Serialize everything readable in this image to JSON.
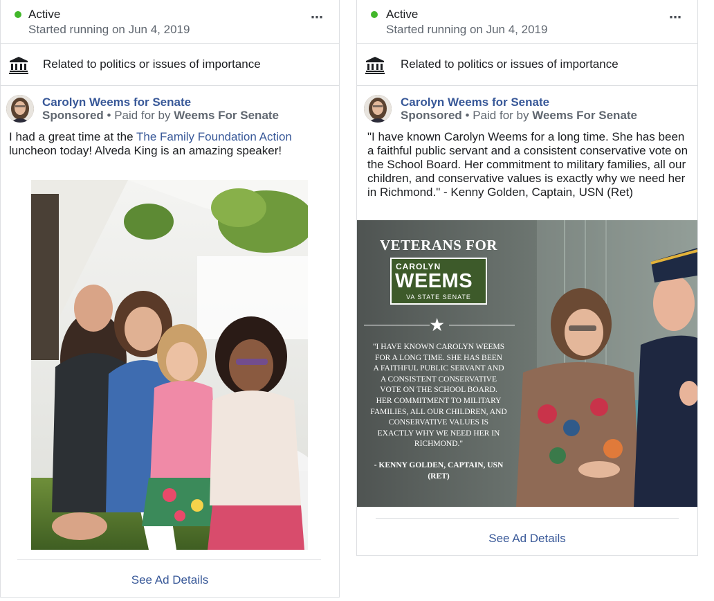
{
  "ads": [
    {
      "status": "Active",
      "started": "Started running on Jun 4, 2019",
      "more_icon": "⋯",
      "category": "Related to politics or issues of importance",
      "page_name": "Carolyn Weems for Senate",
      "sponsored": "Sponsored",
      "bullet": "•",
      "paid_for_prefix": "Paid for by",
      "paid_for_by": "Weems For Senate",
      "text_before_link": "I had a great time at the ",
      "link_text": "The Family Foundation Action",
      "text_after_link": " luncheon today! Alveda King is an amazing speaker!",
      "see_details": "See Ad Details"
    },
    {
      "status": "Active",
      "started": "Started running on Jun 4, 2019",
      "more_icon": "⋯",
      "category": "Related to politics or issues of importance",
      "page_name": "Carolyn Weems for Senate",
      "sponsored": "Sponsored",
      "bullet": "•",
      "paid_for_prefix": "Paid for by",
      "paid_for_by": "Weems For Senate",
      "text": "\"I have known Carolyn Weems for a long time. She has been a faithful public servant and a consistent conservative vote on the School Board. Her commitment to military families, all our children, and conservative values is exactly why we need her in Richmond.\" - Kenny Golden, Captain, USN (Ret)",
      "graphic": {
        "headline": "VETERANS FOR",
        "logo_first": "CAROLYN",
        "logo_last": "WEEMS",
        "logo_sub": "VA STATE SENATE",
        "quote_lines": [
          "\"I HAVE KNOWN CAROLYN WEEMS",
          "FOR A LONG TIME.  SHE HAS BEEN",
          "A FAITHFUL PUBLIC SERVANT AND",
          "A CONSISTENT CONSERVATIVE",
          "VOTE ON THE SCHOOL BOARD.",
          "HER COMMITMENT TO MILITARY",
          "FAMILIES, ALL OUR CHILDREN, AND",
          "CONSERVATIVE VALUES IS",
          "EXACTLY WHY WE NEED HER IN",
          "RICHMOND.\""
        ],
        "attribution_1": "- KENNY GOLDEN, CAPTAIN, USN",
        "attribution_2": "(RET)"
      },
      "see_details": "See Ad Details"
    }
  ],
  "colors": {
    "active_dot": "#42b72a",
    "link": "#385898",
    "muted": "#606770",
    "border": "#dddfe2",
    "logo_green": "#3d5a2a"
  },
  "icons": [
    "status-dot-icon",
    "more-options-icon",
    "government-building-icon",
    "star-icon"
  ]
}
